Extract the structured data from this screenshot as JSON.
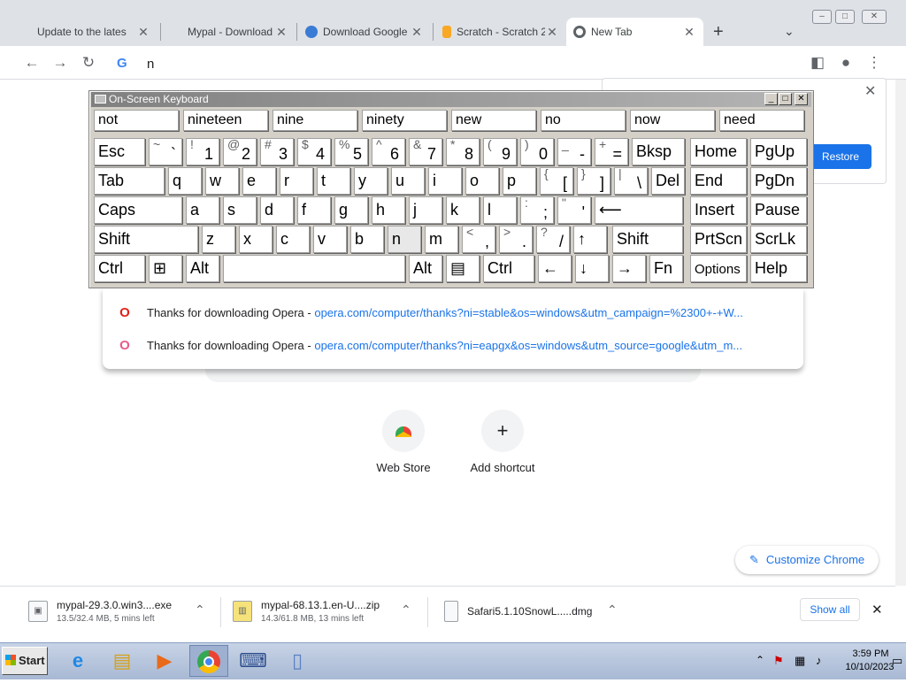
{
  "tabs": [
    {
      "title": "Update to the lates",
      "icon": "apple-icon"
    },
    {
      "title": "Mypal - Download",
      "icon": "mypal-icon"
    },
    {
      "title": "Download Google E",
      "icon": "earth-icon"
    },
    {
      "title": "Scratch - Scratch 2",
      "icon": "scratch-icon"
    },
    {
      "title": "New Tab",
      "icon": "chrome-icon"
    }
  ],
  "omnibox": {
    "value": "n"
  },
  "osk": {
    "title": "On-Screen Keyboard",
    "predictions": [
      "not",
      "nineteen",
      "nine",
      "ninety",
      "new",
      "no",
      "now",
      "need"
    ],
    "row1": [
      {
        "s": "Esc"
      },
      {
        "t": "~",
        "b": "`"
      },
      {
        "t": "!",
        "b": "1"
      },
      {
        "t": "@",
        "b": "2"
      },
      {
        "t": "#",
        "b": "3"
      },
      {
        "t": "$",
        "b": "4"
      },
      {
        "t": "%",
        "b": "5"
      },
      {
        "t": "^",
        "b": "6"
      },
      {
        "t": "&",
        "b": "7"
      },
      {
        "t": "*",
        "b": "8"
      },
      {
        "t": "(",
        "b": "9"
      },
      {
        "t": ")",
        "b": "0"
      },
      {
        "t": "_",
        "b": "-"
      },
      {
        "t": "+",
        "b": "="
      },
      {
        "s": "Bksp"
      },
      {
        "s": "Home"
      },
      {
        "s": "PgUp"
      }
    ],
    "row2": [
      {
        "s": "Tab"
      },
      {
        "s": "q"
      },
      {
        "s": "w"
      },
      {
        "s": "e"
      },
      {
        "s": "r"
      },
      {
        "s": "t"
      },
      {
        "s": "y"
      },
      {
        "s": "u"
      },
      {
        "s": "i"
      },
      {
        "s": "o"
      },
      {
        "s": "p"
      },
      {
        "t": "{",
        "b": "["
      },
      {
        "t": "}",
        "b": "]"
      },
      {
        "t": "|",
        "b": "\\"
      },
      {
        "s": "Del"
      },
      {
        "s": "End"
      },
      {
        "s": "PgDn"
      }
    ],
    "row3": [
      {
        "s": "Caps"
      },
      {
        "s": "a"
      },
      {
        "s": "s"
      },
      {
        "s": "d"
      },
      {
        "s": "f"
      },
      {
        "s": "g"
      },
      {
        "s": "h"
      },
      {
        "s": "j"
      },
      {
        "s": "k"
      },
      {
        "s": "l"
      },
      {
        "t": ":",
        "b": ";"
      },
      {
        "t": "\"",
        "b": "'"
      },
      {
        "s": "⟵"
      },
      {
        "s": "Insert"
      },
      {
        "s": "Pause"
      }
    ],
    "row4": [
      {
        "s": "Shift"
      },
      {
        "s": "z"
      },
      {
        "s": "x"
      },
      {
        "s": "c"
      },
      {
        "s": "v"
      },
      {
        "s": "b"
      },
      {
        "s": "n"
      },
      {
        "s": "m"
      },
      {
        "t": "<",
        "b": ","
      },
      {
        "t": ">",
        "b": "."
      },
      {
        "t": "?",
        "b": "/"
      },
      {
        "s": "↑"
      },
      {
        "s": "Shift"
      },
      {
        "s": "PrtScn"
      },
      {
        "s": "ScrLk"
      }
    ],
    "row5": [
      {
        "s": "Ctrl"
      },
      {
        "s": "⊞"
      },
      {
        "s": "Alt"
      },
      {
        "s": ""
      },
      {
        "s": "Alt"
      },
      {
        "s": "▤"
      },
      {
        "s": "Ctrl"
      },
      {
        "s": "←"
      },
      {
        "s": "↓"
      },
      {
        "s": "→"
      },
      {
        "s": "Fn"
      },
      {
        "s": "Options"
      },
      {
        "s": "Help"
      }
    ]
  },
  "suggestions": [
    {
      "text": "Thanks for downloading Opera",
      "sep": " - ",
      "url": "opera.com/computer/thanks?ni=stable&os=windows&utm_campaign=%2300+-+W...",
      "icon": "opera-icon"
    },
    {
      "text": "Thanks for downloading Opera",
      "sep": " - ",
      "url": "opera.com/computer/thanks?ni=eapgx&os=windows&utm_source=google&utm_m...",
      "icon": "opera-gx-icon"
    }
  ],
  "restore": {
    "button": "Restore"
  },
  "shortcuts": [
    {
      "label": "Web Store",
      "icon": "web-store-icon"
    },
    {
      "label": "Add shortcut",
      "icon": "plus-icon"
    }
  ],
  "customize": {
    "label": "Customize Chrome"
  },
  "downloads": {
    "items": [
      {
        "name": "mypal-29.3.0.win3....exe",
        "status": "13.5/32.4 MB, 5 mins left"
      },
      {
        "name": "mypal-68.13.1.en-U....zip",
        "status": "14.3/61.8 MB, 13 mins left"
      },
      {
        "name": "Safari5.1.10SnowL.....dmg",
        "status": ""
      }
    ],
    "show_all": "Show all"
  },
  "taskbar": {
    "start": "Start",
    "time": "3:59 PM",
    "date": "10/10/2023"
  },
  "colors": {
    "accent": "#1a73e8",
    "osk_bg": "#d4d0c8"
  }
}
